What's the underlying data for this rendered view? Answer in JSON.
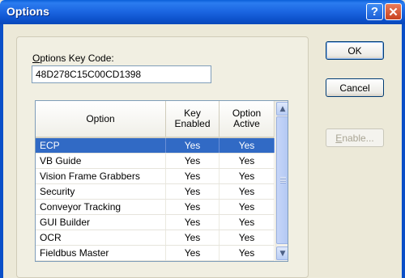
{
  "window": {
    "title": "Options",
    "help_glyph": "?",
    "close_glyph": "✕"
  },
  "key_code": {
    "label_underlined": "O",
    "label_rest": "ptions Key Code:",
    "value": "48D278C15C00CD1398"
  },
  "list": {
    "headers": {
      "option": "Option",
      "key_enabled_1": "Key",
      "key_enabled_2": "Enabled",
      "option_active_1": "Option",
      "option_active_2": "Active"
    },
    "rows": [
      {
        "option": "ECP",
        "key_enabled": "Yes",
        "option_active": "Yes",
        "selected": true
      },
      {
        "option": "VB Guide",
        "key_enabled": "Yes",
        "option_active": "Yes"
      },
      {
        "option": "Vision Frame Grabbers",
        "key_enabled": "Yes",
        "option_active": "Yes"
      },
      {
        "option": "Security",
        "key_enabled": "Yes",
        "option_active": "Yes"
      },
      {
        "option": "Conveyor Tracking",
        "key_enabled": "Yes",
        "option_active": "Yes"
      },
      {
        "option": "GUI Builder",
        "key_enabled": "Yes",
        "option_active": "Yes"
      },
      {
        "option": "OCR",
        "key_enabled": "Yes",
        "option_active": "Yes"
      },
      {
        "option": "Fieldbus Master",
        "key_enabled": "Yes",
        "option_active": "Yes"
      }
    ]
  },
  "buttons": {
    "ok": "OK",
    "cancel": "Cancel",
    "enable_underlined": "E",
    "enable_rest": "nable...",
    "enable_disabled": true
  },
  "colors": {
    "titlebar": "#0a5fd8",
    "selection": "#316ac5",
    "dialog_bg": "#ece9d8"
  },
  "icons": {
    "scroll_up": "▲",
    "scroll_down": "▼"
  }
}
